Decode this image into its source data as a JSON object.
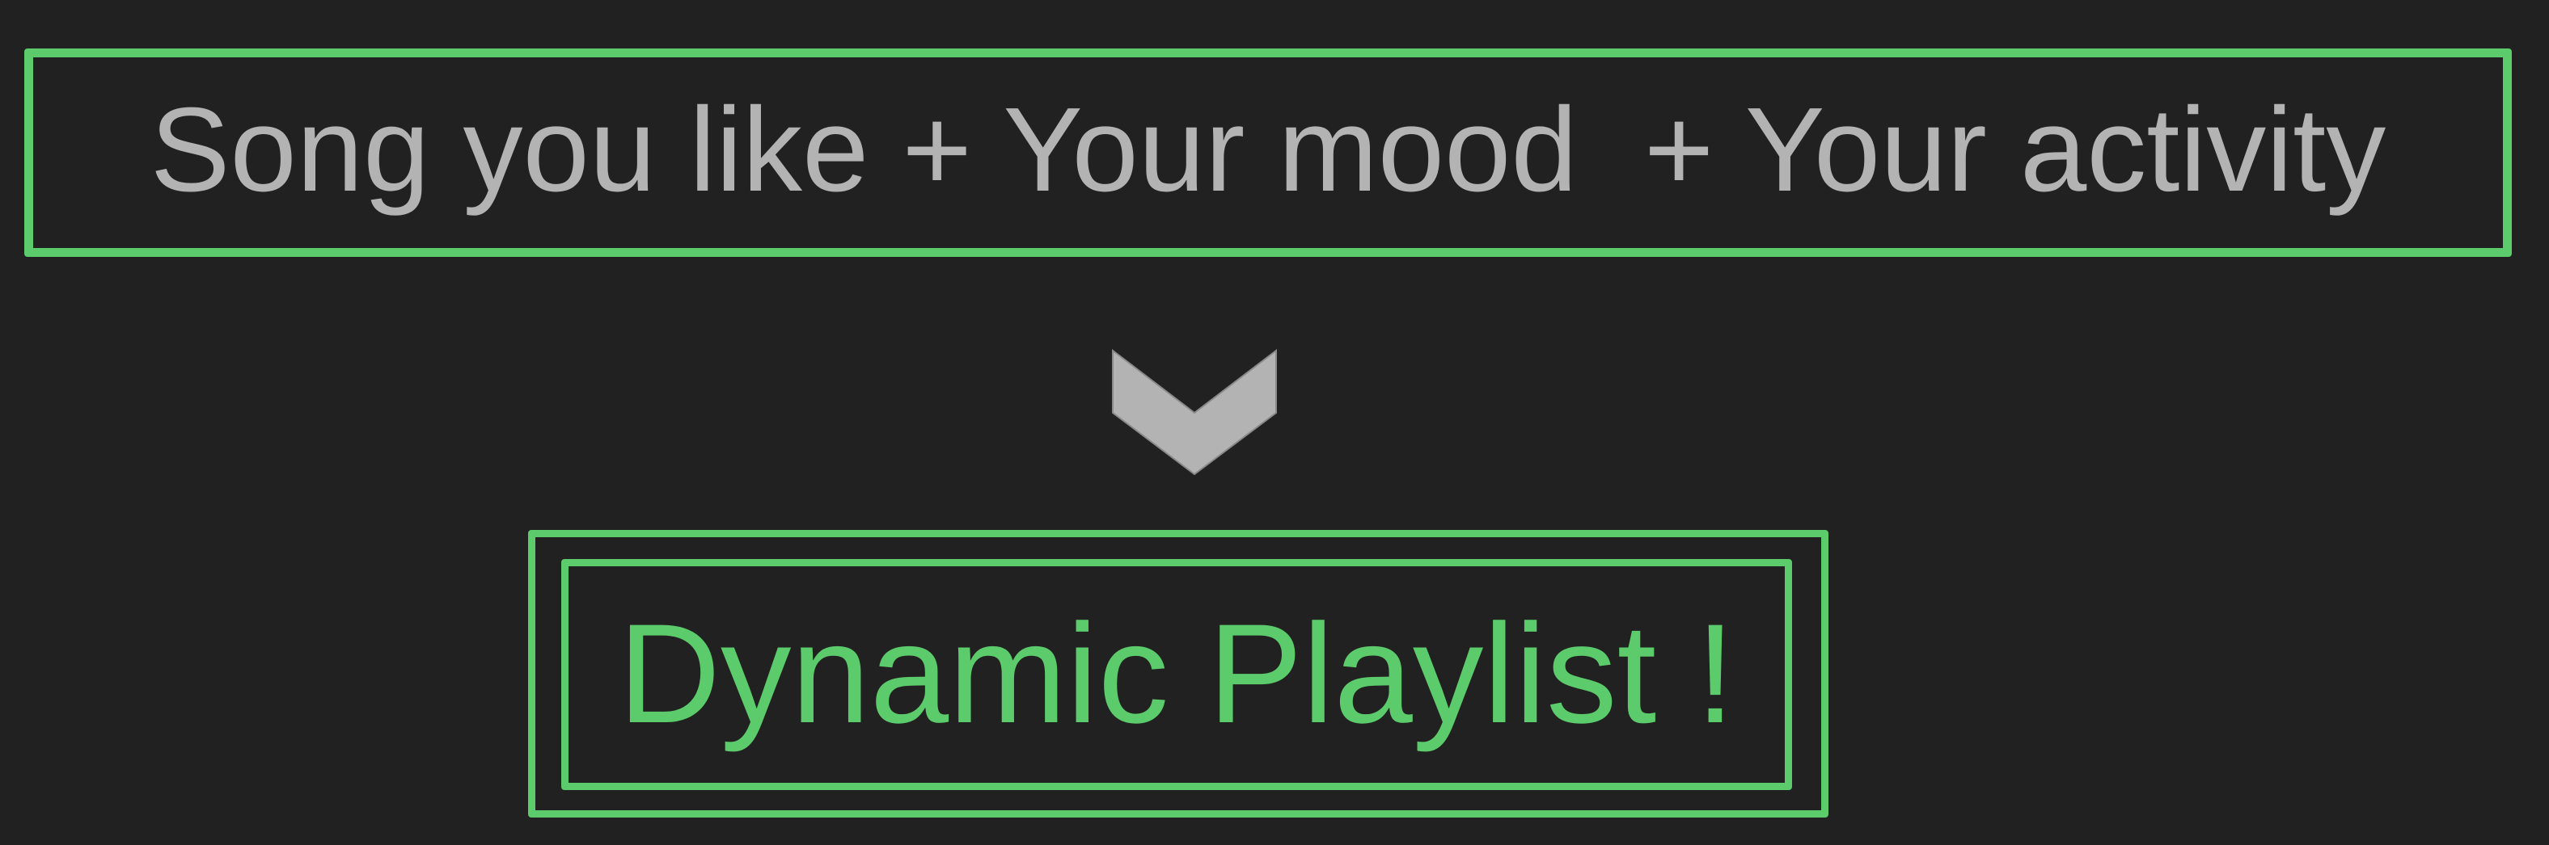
{
  "input": {
    "formula": "Song you like + Your mood  + Your activity"
  },
  "connector": {
    "icon": "chevron-down-icon",
    "color": "#b3b3b3"
  },
  "output": {
    "label": "Dynamic Playlist !"
  },
  "colors": {
    "background": "#212121",
    "accent_green": "#5ccb6b",
    "text_gray": "#b3b3b3"
  }
}
